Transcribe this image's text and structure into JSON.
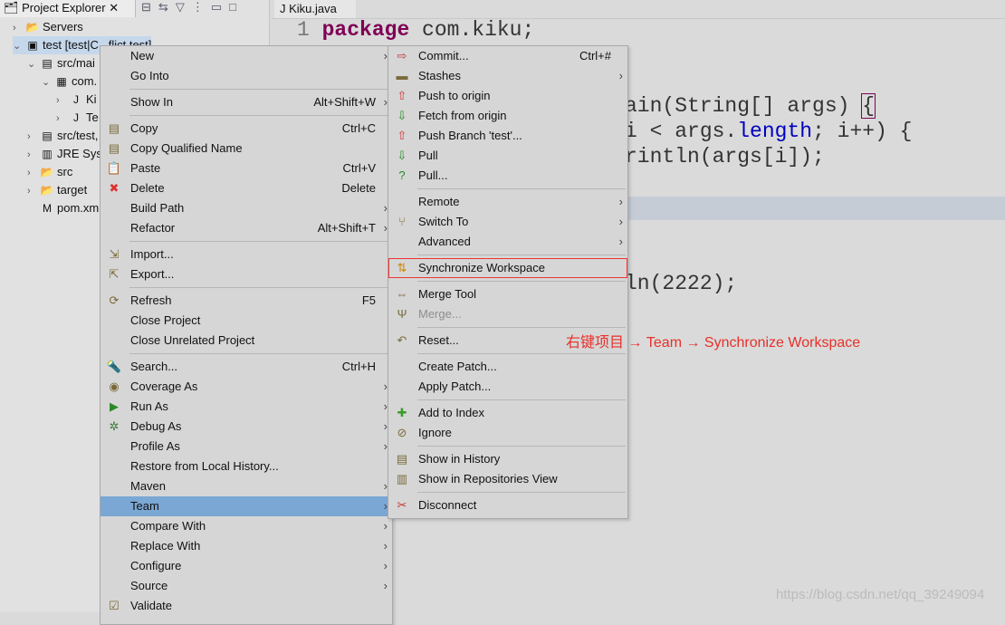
{
  "explorer": {
    "tab_title": "Project Explorer",
    "toolbar_icons": [
      "collapse-all-icon",
      "link-editor-icon",
      "filter-icon",
      "view-menu-icon",
      "minimize-icon",
      "maximize-icon"
    ],
    "tree": [
      {
        "label": "Servers",
        "indent": 0,
        "chev": "›",
        "icon": "folder-icon"
      },
      {
        "label": "test [test|C...flict test]",
        "indent": 0,
        "chev": "⌄",
        "icon": "maven-project-icon",
        "selected": true
      },
      {
        "label": "src/mai",
        "indent": 1,
        "chev": "⌄",
        "icon": "source-folder-icon"
      },
      {
        "label": "com.",
        "indent": 2,
        "chev": "⌄",
        "icon": "package-icon"
      },
      {
        "label": "Ki",
        "indent": 3,
        "chev": "›",
        "icon": "java-file-icon"
      },
      {
        "label": "Te",
        "indent": 3,
        "chev": "›",
        "icon": "java-file-icon"
      },
      {
        "label": "src/test,",
        "indent": 1,
        "chev": "›",
        "icon": "source-folder-icon"
      },
      {
        "label": "JRE Syst",
        "indent": 1,
        "chev": "›",
        "icon": "library-icon"
      },
      {
        "label": "src",
        "indent": 1,
        "chev": "›",
        "icon": "folder-icon"
      },
      {
        "label": "target",
        "indent": 1,
        "chev": "›",
        "icon": "folder-icon"
      },
      {
        "label": "pom.xm",
        "indent": 1,
        "chev": "",
        "icon": "xml-file-icon"
      }
    ]
  },
  "editor": {
    "tab_title": "Kiku.java",
    "line_number": "1",
    "line1_keyword": "package",
    "line1_rest": " com.kiku;",
    "frag1": "ain(String[] args) ",
    "frag1_brace": "{",
    "frag2_a": "i < args.",
    "frag2_field": "length",
    "frag2_b": "; i++) {",
    "frag3": "rintln(args[i]);",
    "frag4": "ln(2222);"
  },
  "context_menu": [
    {
      "label": "New",
      "arrow": true
    },
    {
      "label": "Go Into"
    },
    {
      "sep": true
    },
    {
      "label": "Show In",
      "shortcut": "Alt+Shift+W",
      "arrow": true
    },
    {
      "sep": true
    },
    {
      "label": "Copy",
      "shortcut": "Ctrl+C",
      "icon": "copy-icon"
    },
    {
      "label": "Copy Qualified Name",
      "icon": "copy-qualified-icon"
    },
    {
      "label": "Paste",
      "shortcut": "Ctrl+V",
      "icon": "paste-icon"
    },
    {
      "label": "Delete",
      "shortcut": "Delete",
      "icon": "delete-icon"
    },
    {
      "label": "Build Path",
      "arrow": true
    },
    {
      "label": "Refactor",
      "shortcut": "Alt+Shift+T",
      "arrow": true
    },
    {
      "sep": true
    },
    {
      "label": "Import...",
      "icon": "import-icon"
    },
    {
      "label": "Export...",
      "icon": "export-icon"
    },
    {
      "sep": true
    },
    {
      "label": "Refresh",
      "shortcut": "F5",
      "icon": "refresh-icon"
    },
    {
      "label": "Close Project"
    },
    {
      "label": "Close Unrelated Project"
    },
    {
      "sep": true
    },
    {
      "label": "Search...",
      "shortcut": "Ctrl+H",
      "icon": "search-icon"
    },
    {
      "label": "Coverage As",
      "arrow": true,
      "icon": "coverage-icon"
    },
    {
      "label": "Run As",
      "arrow": true,
      "icon": "run-icon"
    },
    {
      "label": "Debug As",
      "arrow": true,
      "icon": "debug-icon"
    },
    {
      "label": "Profile As",
      "arrow": true
    },
    {
      "label": "Restore from Local History..."
    },
    {
      "label": "Maven",
      "arrow": true
    },
    {
      "label": "Team",
      "arrow": true,
      "highlighted": true
    },
    {
      "label": "Compare With",
      "arrow": true
    },
    {
      "label": "Replace With",
      "arrow": true
    },
    {
      "label": "Configure",
      "arrow": true
    },
    {
      "label": "Source",
      "arrow": true
    },
    {
      "label": "Validate",
      "icon": "checkbox-checked-icon"
    }
  ],
  "team_menu": [
    {
      "label": "Commit...",
      "shortcut": "Ctrl+#",
      "icon": "commit-icon"
    },
    {
      "label": "Stashes",
      "arrow": true,
      "icon": "stash-icon"
    },
    {
      "label": "Push to origin",
      "icon": "push-icon"
    },
    {
      "label": "Fetch from origin",
      "icon": "fetch-icon"
    },
    {
      "label": "Push Branch 'test'...",
      "icon": "push-branch-icon"
    },
    {
      "label": "Pull",
      "icon": "pull-icon"
    },
    {
      "label": "Pull...",
      "icon": "pull-dialog-icon"
    },
    {
      "sep": true
    },
    {
      "label": "Remote",
      "arrow": true
    },
    {
      "label": "Switch To",
      "arrow": true,
      "icon": "switch-branch-icon"
    },
    {
      "label": "Advanced",
      "arrow": true
    },
    {
      "sep": true
    },
    {
      "label": "Synchronize Workspace",
      "icon": "synchronize-icon",
      "boxed": true
    },
    {
      "sep": true
    },
    {
      "label": "Merge Tool",
      "icon": "merge-tool-icon"
    },
    {
      "label": "Merge...",
      "icon": "merge-icon",
      "disabled": true
    },
    {
      "sep": true
    },
    {
      "label": "Reset...",
      "icon": "reset-icon"
    },
    {
      "sep": true
    },
    {
      "label": "Create Patch..."
    },
    {
      "label": "Apply Patch..."
    },
    {
      "sep": true
    },
    {
      "label": "Add to Index",
      "icon": "add-icon"
    },
    {
      "label": "Ignore",
      "icon": "ignore-icon"
    },
    {
      "sep": true
    },
    {
      "label": "Show in History",
      "icon": "history-icon"
    },
    {
      "label": "Show in Repositories View",
      "icon": "git-repo-icon"
    },
    {
      "sep": true
    },
    {
      "label": "Disconnect",
      "icon": "disconnect-icon"
    }
  ],
  "annotation": "右键项目 → Team → Synchronize Workspace",
  "watermark": "https://blog.csdn.net/qq_39249094",
  "colors": {
    "highlight": "#7ba7d4",
    "annotation": "#e8302a",
    "keyword": "#7f0055"
  }
}
